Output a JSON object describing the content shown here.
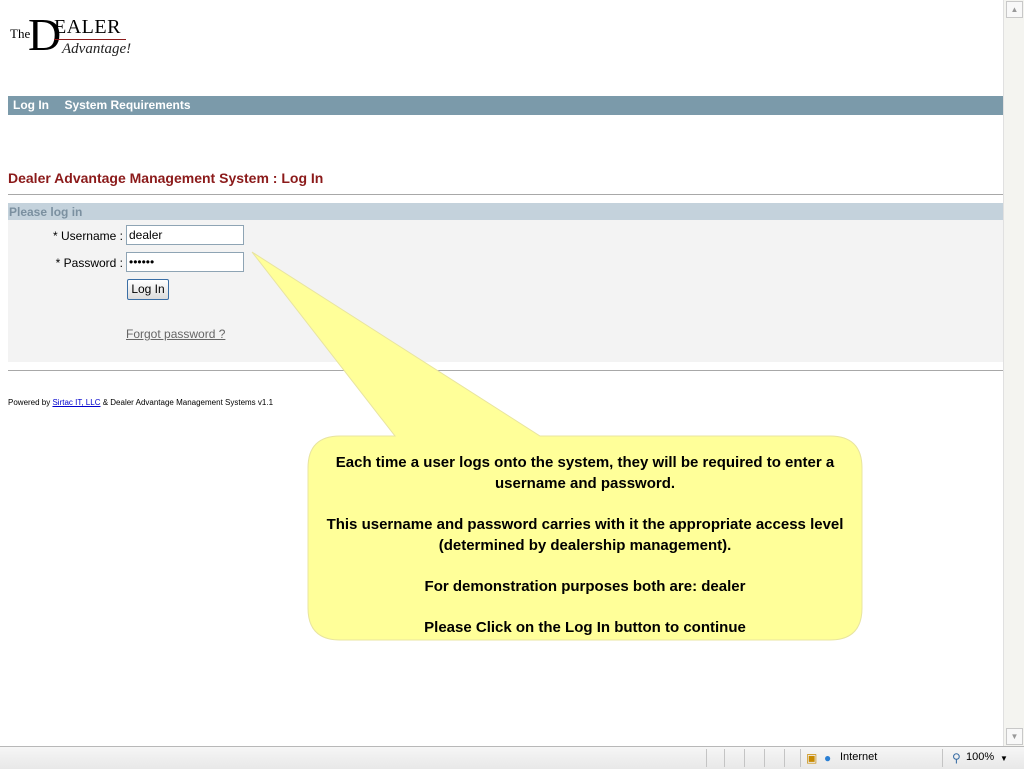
{
  "logo": {
    "the": "The",
    "big_d": "D",
    "ealer": "EALER",
    "advantage": "Advantage!"
  },
  "nav": {
    "login": "Log In",
    "requirements": "System Requirements"
  },
  "page_title": "Dealer Advantage Management System : Log In",
  "panel": {
    "header": "Please log in",
    "username_label": "* Username :",
    "username_value": "dealer",
    "password_label": "* Password :",
    "password_value": "dealer",
    "login_button": "Log In",
    "forgot_link": "Forgot password ?"
  },
  "footer": {
    "prefix": "Powered by ",
    "link": "Sirtac IT, LLC",
    "suffix": " & Dealer Advantage Management Systems v1.1"
  },
  "callout": {
    "para1": "Each time a user logs onto the system, they will be required to enter a username and password.",
    "para2": "This username and password carries with it the appropriate access level (determined by dealership management).",
    "para3": "For demonstration purposes both are: dealer",
    "para4": "Please Click on the Log In button to continue",
    "fill_color": "#ffff99"
  },
  "statusbar": {
    "zone": "Internet",
    "zoom": "100%"
  }
}
